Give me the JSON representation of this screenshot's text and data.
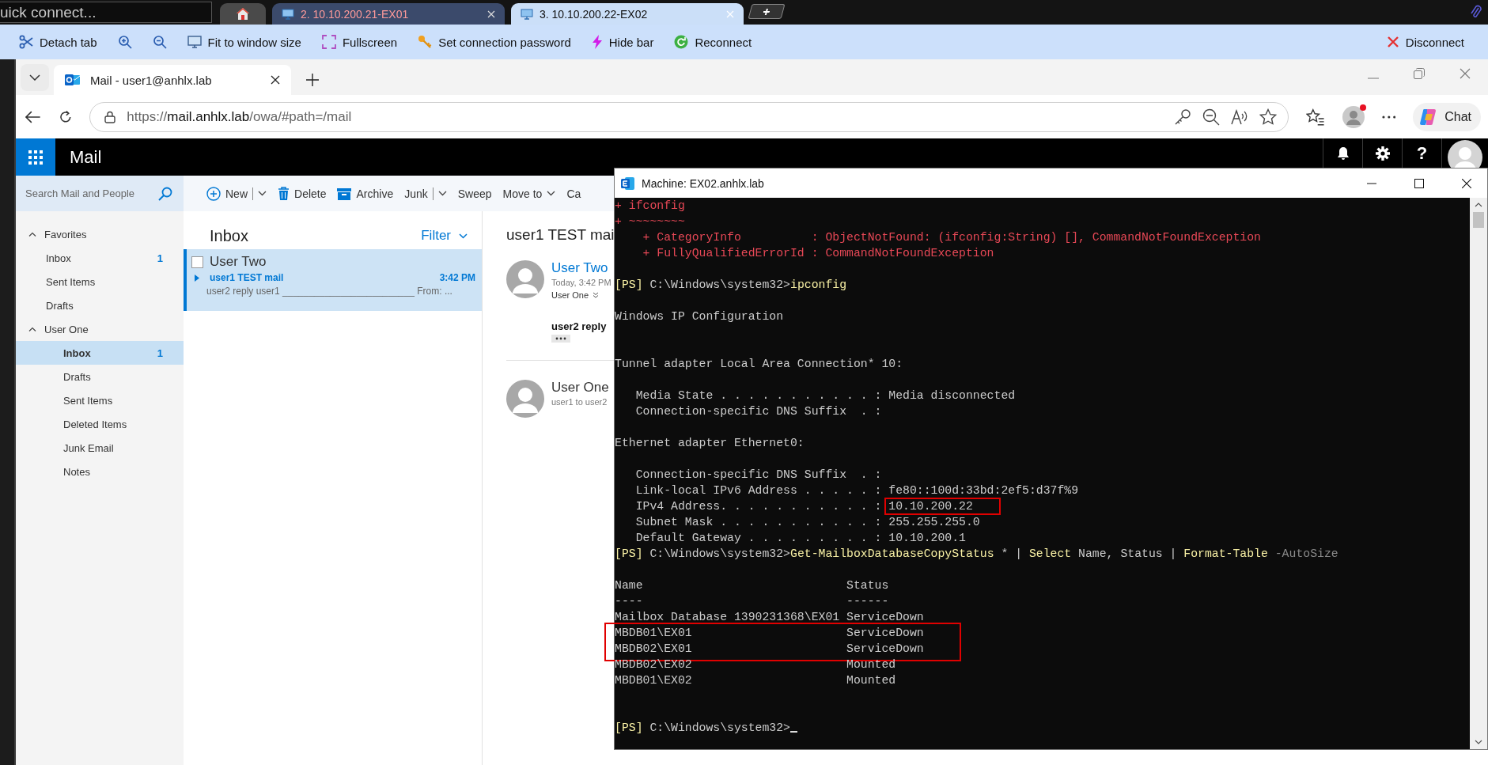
{
  "quick_connect": {
    "placeholder": "uick connect..."
  },
  "remote_tabs": [
    {
      "kind": "home",
      "selected": false
    },
    {
      "kind": "session",
      "label": "2. 10.10.200.21-EX01",
      "selected": false
    },
    {
      "kind": "session",
      "label": "3. 10.10.200.22-EX02",
      "selected": true
    }
  ],
  "toolbar": {
    "items": [
      {
        "kind": "text",
        "label": "Detach tab"
      },
      {
        "kind": "icon"
      },
      {
        "kind": "icon"
      },
      {
        "kind": "text",
        "label": "Fit to window size"
      },
      {
        "kind": "text",
        "label": "Fullscreen"
      },
      {
        "kind": "text",
        "label": "Set connection password"
      },
      {
        "kind": "text",
        "label": "Hide bar"
      },
      {
        "kind": "text",
        "label": "Reconnect"
      }
    ],
    "disconnect": {
      "label": "Disconnect"
    }
  },
  "browser": {
    "tab": {
      "title": "Mail - user1@anhlx.lab"
    },
    "url": {
      "scheme": "https://",
      "host": "mail.anhlx.lab",
      "path": "/owa/#path=/mail"
    },
    "profile_notification": true,
    "chat": {
      "label": "Chat"
    }
  },
  "owa": {
    "app_title": "Mail",
    "help": "?",
    "search": {
      "placeholder": "Search Mail and People"
    },
    "commands": [
      {
        "kind": "split",
        "label": "New"
      },
      {
        "kind": "plain",
        "label": "Delete"
      },
      {
        "kind": "plain",
        "label": "Archive"
      },
      {
        "kind": "split",
        "label": "Junk"
      },
      {
        "kind": "plain",
        "label": "Sweep"
      },
      {
        "kind": "dropdown",
        "label": "Move to"
      },
      {
        "kind": "plain",
        "label": "Ca"
      }
    ],
    "nav": [
      {
        "kind": "favorites",
        "label": "Favorites",
        "expanded": true,
        "children": [
          {
            "label": "Inbox",
            "count": "1",
            "selected": false
          },
          {
            "label": "Sent Items",
            "selected": false
          },
          {
            "label": "Drafts",
            "selected": false
          }
        ]
      },
      {
        "kind": "account",
        "label": "User One",
        "expanded": true,
        "children": [
          {
            "label": "Inbox",
            "count": "1",
            "selected": true
          },
          {
            "label": "Drafts",
            "selected": false
          },
          {
            "label": "Sent Items",
            "selected": false
          },
          {
            "label": "Deleted Items",
            "selected": false
          },
          {
            "label": "Junk Email",
            "selected": false
          },
          {
            "label": "Notes",
            "selected": false
          }
        ]
      }
    ],
    "list": {
      "title": "Inbox",
      "filter": "Filter",
      "messages": [
        {
          "sender": "User Two",
          "subject": "user1 TEST mail",
          "time": "3:42 PM",
          "preview": "user2 reply user1 _________________________ From: ...",
          "selected": true,
          "checked": false
        }
      ]
    },
    "reading": {
      "title": "user1 TEST mai",
      "items": [
        {
          "kind": "expanded",
          "sender": "User Two",
          "time": "Today, 3:42 PM",
          "recipient": "User One",
          "body": "user2 reply"
        },
        {
          "kind": "collapsed",
          "sender": "User One",
          "snippet": "user1 to user2"
        }
      ]
    }
  },
  "terminal": {
    "title": "Machine: EX02.anhlx.lab",
    "lines": [
      {
        "kind": "output",
        "segments": [
          {
            "kind": "error",
            "text": "+ ifconfig"
          }
        ]
      },
      {
        "kind": "output",
        "segments": [
          {
            "kind": "error",
            "text": "+ ~~~~~~~~"
          }
        ]
      },
      {
        "kind": "output",
        "segments": [
          {
            "kind": "error",
            "text": "    + CategoryInfo          : ObjectNotFound: (ifconfig:String) [], CommandNotFoundException"
          }
        ]
      },
      {
        "kind": "output",
        "segments": [
          {
            "kind": "error",
            "text": "    + FullyQualifiedErrorId : CommandNotFoundException"
          }
        ]
      },
      {
        "kind": "blank"
      },
      {
        "kind": "output",
        "segments": [
          {
            "kind": "prompt",
            "text": "[PS]"
          },
          {
            "kind": "path",
            "text": " C:\\Windows\\system32>"
          },
          {
            "kind": "command",
            "text": "ipconfig"
          }
        ]
      },
      {
        "kind": "blank"
      },
      {
        "kind": "output",
        "segments": [
          {
            "kind": "text",
            "text": "Windows IP Configuration"
          }
        ]
      },
      {
        "kind": "blank"
      },
      {
        "kind": "blank"
      },
      {
        "kind": "output",
        "segments": [
          {
            "kind": "text",
            "text": "Tunnel adapter Local Area Connection* 10:"
          }
        ]
      },
      {
        "kind": "blank"
      },
      {
        "kind": "output",
        "segments": [
          {
            "kind": "text",
            "text": "   Media State . . . . . . . . . . . : Media disconnected"
          }
        ]
      },
      {
        "kind": "output",
        "segments": [
          {
            "kind": "text",
            "text": "   Connection-specific DNS Suffix  . :"
          }
        ]
      },
      {
        "kind": "blank"
      },
      {
        "kind": "output",
        "segments": [
          {
            "kind": "text",
            "text": "Ethernet adapter Ethernet0:"
          }
        ]
      },
      {
        "kind": "blank"
      },
      {
        "kind": "output",
        "segments": [
          {
            "kind": "text",
            "text": "   Connection-specific DNS Suffix  . :"
          }
        ]
      },
      {
        "kind": "output",
        "segments": [
          {
            "kind": "text",
            "text": "   Link-local IPv6 Address . . . . . : fe80::100d:33bd:2ef5:d37f%9"
          }
        ]
      },
      {
        "kind": "output",
        "segments": [
          {
            "kind": "text",
            "text": "   IPv4 Address. . . . . . . . . . . : "
          },
          {
            "kind": "text",
            "text": "10.10.200.22",
            "boxed": true
          }
        ]
      },
      {
        "kind": "output",
        "segments": [
          {
            "kind": "text",
            "text": "   Subnet Mask . . . . . . . . . . . : 255.255.255.0"
          }
        ]
      },
      {
        "kind": "output",
        "segments": [
          {
            "kind": "text",
            "text": "   Default Gateway . . . . . . . . . : 10.10.200.1"
          }
        ]
      },
      {
        "kind": "output",
        "segments": [
          {
            "kind": "prompt",
            "text": "[PS]"
          },
          {
            "kind": "path",
            "text": " C:\\Windows\\system32>"
          },
          {
            "kind": "command",
            "text": "Get-MailboxDatabaseCopyStatus"
          },
          {
            "kind": "text",
            "text": " * | "
          },
          {
            "kind": "command",
            "text": "Select"
          },
          {
            "kind": "text",
            "text": " Name, Status | "
          },
          {
            "kind": "command",
            "text": "Format-Table"
          },
          {
            "kind": "param",
            "text": " -AutoSize"
          }
        ]
      },
      {
        "kind": "blank"
      },
      {
        "kind": "output",
        "segments": [
          {
            "kind": "text",
            "text": "Name                             Status"
          }
        ]
      },
      {
        "kind": "output",
        "segments": [
          {
            "kind": "text",
            "text": "----                             ------"
          }
        ]
      },
      {
        "kind": "output",
        "segments": [
          {
            "kind": "text",
            "text": "Mailbox Database 1390231368\\EX01 ServiceDown"
          }
        ]
      },
      {
        "kind": "output",
        "boxed": true,
        "segments": [
          {
            "kind": "text",
            "text": "MBDB01\\EX01                      ServiceDown"
          }
        ]
      },
      {
        "kind": "output",
        "boxed": true,
        "segments": [
          {
            "kind": "text",
            "text": "MBDB02\\EX01                      ServiceDown"
          }
        ]
      },
      {
        "kind": "output",
        "segments": [
          {
            "kind": "text",
            "text": "MBDB02\\EX02                      Mounted"
          }
        ]
      },
      {
        "kind": "output",
        "segments": [
          {
            "kind": "text",
            "text": "MBDB01\\EX02                      Mounted"
          }
        ]
      },
      {
        "kind": "blank"
      },
      {
        "kind": "blank"
      },
      {
        "kind": "output",
        "cursor": true,
        "segments": [
          {
            "kind": "prompt",
            "text": "[PS]"
          },
          {
            "kind": "path",
            "text": " C:\\Windows\\system32>"
          }
        ]
      }
    ]
  }
}
